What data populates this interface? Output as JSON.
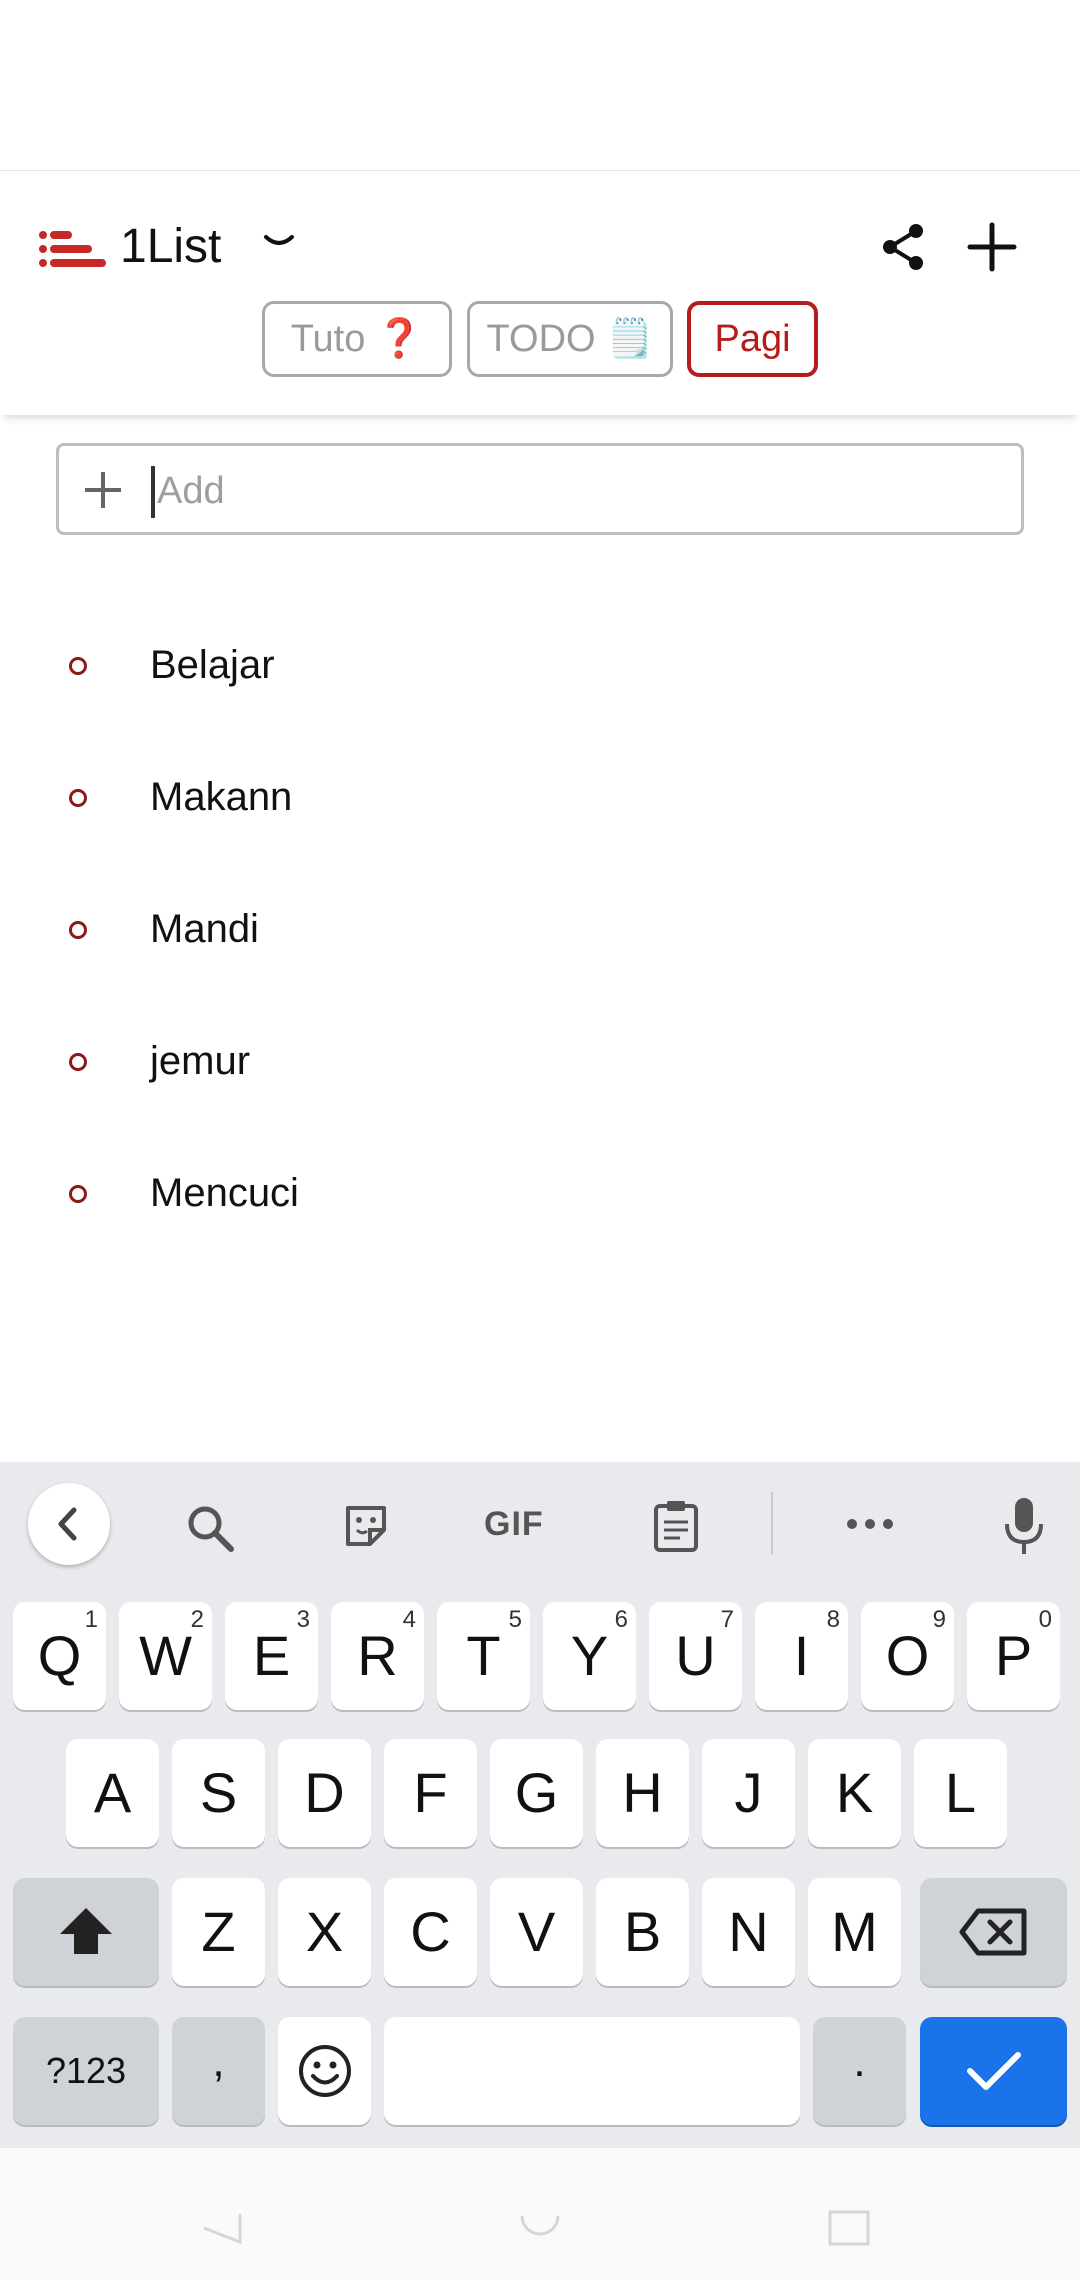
{
  "header": {
    "title": "1List",
    "tabs": [
      {
        "label": "Tuto ❓",
        "active": false
      },
      {
        "label": "TODO 🗒️",
        "active": false
      },
      {
        "label": "Pagi",
        "active": true
      }
    ]
  },
  "add_field": {
    "placeholder": "Add",
    "value": ""
  },
  "list": {
    "items": [
      {
        "label": "Belajar"
      },
      {
        "label": "Makann"
      },
      {
        "label": "Mandi"
      },
      {
        "label": "jemur"
      },
      {
        "label": "Mencuci"
      }
    ]
  },
  "keyboard": {
    "toolbar": {
      "gif_label": "GIF"
    },
    "row1": [
      {
        "key": "Q",
        "hint": "1"
      },
      {
        "key": "W",
        "hint": "2"
      },
      {
        "key": "E",
        "hint": "3"
      },
      {
        "key": "R",
        "hint": "4"
      },
      {
        "key": "T",
        "hint": "5"
      },
      {
        "key": "Y",
        "hint": "6"
      },
      {
        "key": "U",
        "hint": "7"
      },
      {
        "key": "I",
        "hint": "8"
      },
      {
        "key": "O",
        "hint": "9"
      },
      {
        "key": "P",
        "hint": "0"
      }
    ],
    "row2": [
      "A",
      "S",
      "D",
      "F",
      "G",
      "H",
      "J",
      "K",
      "L"
    ],
    "row3": [
      "Z",
      "X",
      "C",
      "V",
      "B",
      "N",
      "M"
    ],
    "bottom": {
      "symbols": "?123",
      "comma": ",",
      "period": "."
    }
  },
  "colors": {
    "accent": "#b71c1c",
    "bullet": "#8b1a1a",
    "keyboard_bg": "#e8eaed",
    "enter_key": "#1a73e8"
  }
}
